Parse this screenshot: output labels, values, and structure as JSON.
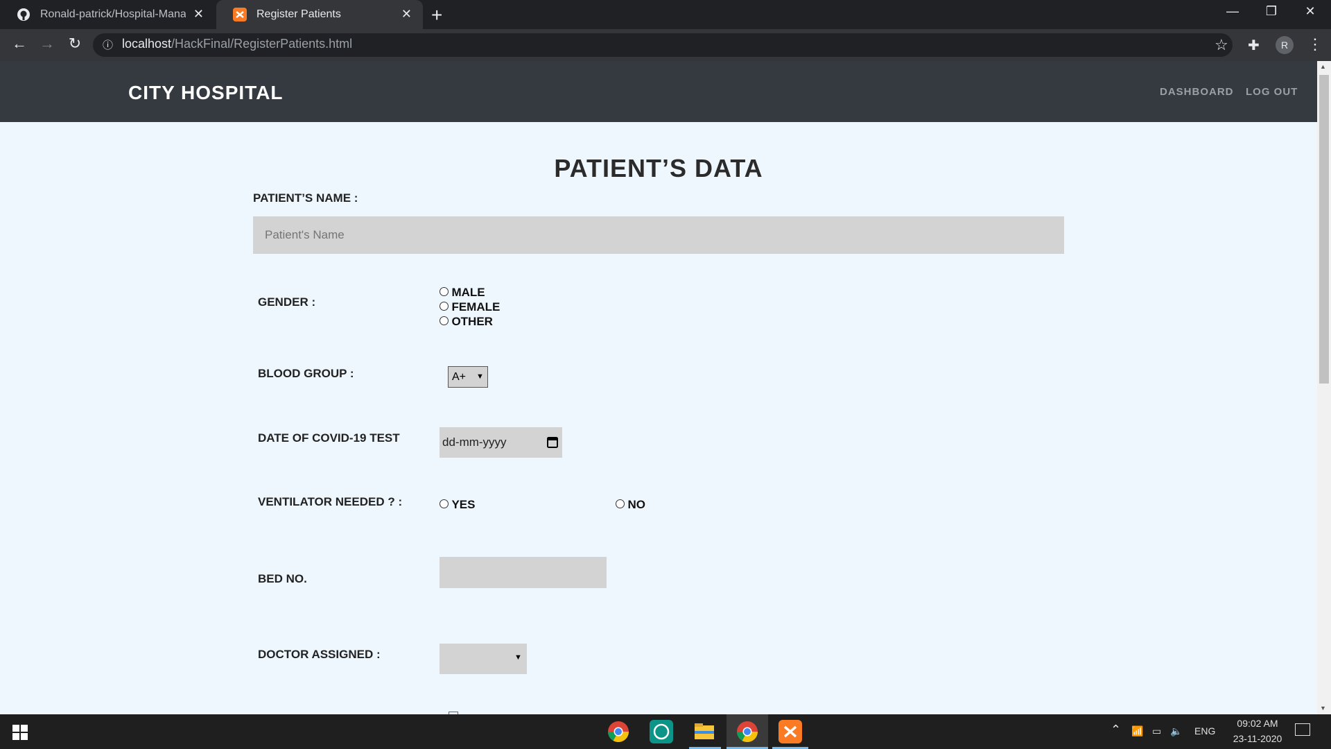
{
  "browser": {
    "tabs": [
      {
        "title": "Ronald-patrick/Hospital-Management",
        "icon": "github-icon"
      },
      {
        "title": "Register Patients",
        "icon": "xampp-icon"
      }
    ],
    "url_host": "localhost",
    "url_path": "/HackFinal/RegisterPatients.html",
    "profile_initial": "R"
  },
  "navbar": {
    "brand": "CITY HOSPITAL",
    "links": [
      "DASHBOARD",
      "LOG OUT"
    ]
  },
  "form": {
    "heading": "PATIENT’S DATA",
    "name_label": "PATIENT’S NAME :",
    "name_placeholder": "Patient's Name",
    "gender_label": "GENDER :",
    "gender_options": [
      "MALE",
      "FEMALE",
      "OTHER"
    ],
    "blood_label": "BLOOD GROUP :",
    "blood_value": "A+",
    "covid_label": "DATE OF COVID-19 TEST",
    "date_placeholder": "dd-mm-yyyy",
    "ventilator_label": "VENTILATOR NEEDED ? :",
    "ventilator_options": [
      "YES",
      "NO"
    ],
    "bed_label": "BED NO.",
    "doctor_label": "DOCTOR ASSIGNED :"
  },
  "taskbar": {
    "time": "09:02 AM",
    "date": "23-11-2020",
    "lang": "ENG"
  },
  "colors": {
    "navbar_bg": "#343a40",
    "page_bg": "#eef7fd",
    "input_bg": "#d3d3d3"
  }
}
